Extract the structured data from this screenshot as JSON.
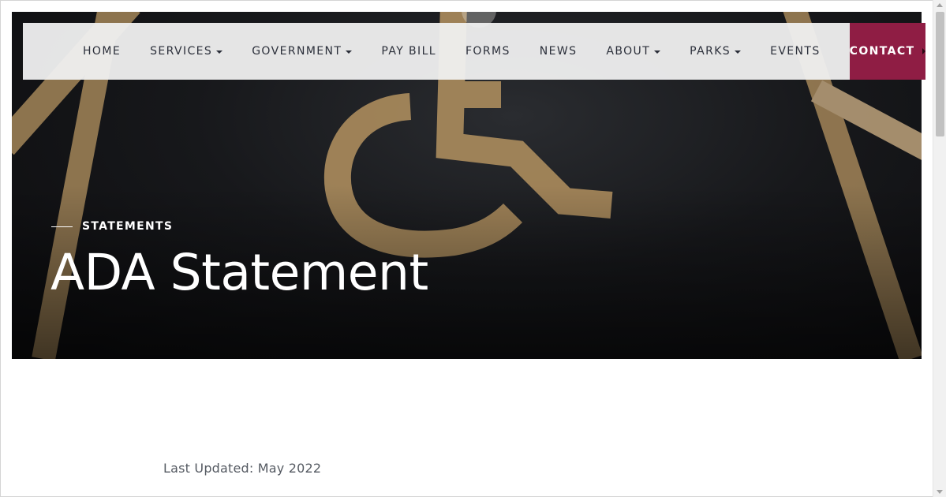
{
  "nav": {
    "items": [
      {
        "label": "HOME",
        "dropdown": false
      },
      {
        "label": "SERVICES",
        "dropdown": true
      },
      {
        "label": "GOVERNMENT",
        "dropdown": true
      },
      {
        "label": "PAY BILL",
        "dropdown": false
      },
      {
        "label": "FORMS",
        "dropdown": false
      },
      {
        "label": "NEWS",
        "dropdown": false
      },
      {
        "label": "ABOUT",
        "dropdown": true
      },
      {
        "label": "PARKS",
        "dropdown": true
      },
      {
        "label": "EVENTS",
        "dropdown": false
      }
    ],
    "contact_label": "CONTACT"
  },
  "hero": {
    "eyebrow": "STATEMENTS",
    "title": "ADA Statement",
    "image_subject": "wheelchair-accessibility-symbol-on-asphalt"
  },
  "content": {
    "last_updated": "Last Updated: May 2022"
  },
  "colors": {
    "accent": "#8f1d44",
    "nav_bg": "#f0f0f0",
    "nav_text": "#2b2f3a",
    "paint": "#a98a5c"
  }
}
